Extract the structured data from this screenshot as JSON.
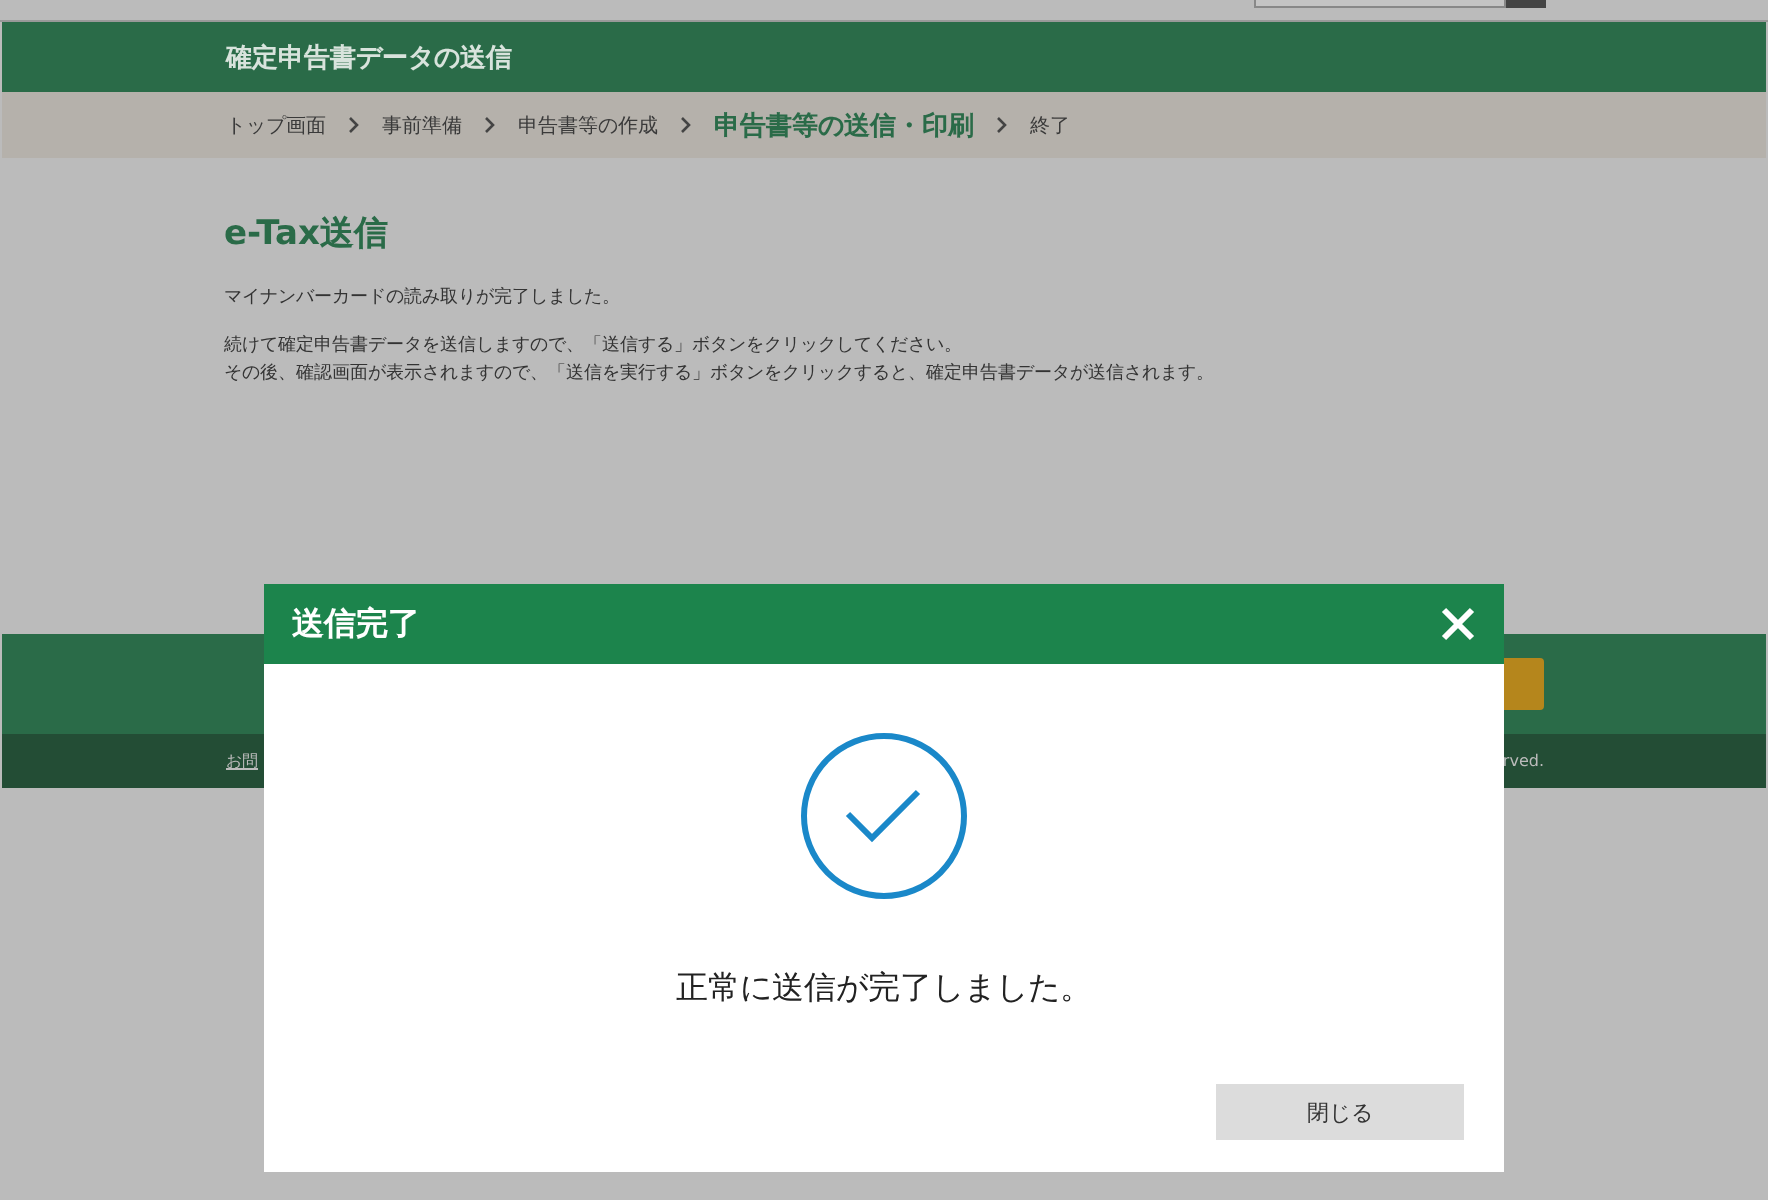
{
  "header": {
    "title": "確定申告書データの送信"
  },
  "breadcrumb": [
    {
      "label": "トップ画面",
      "selected": false
    },
    {
      "label": "事前準備",
      "selected": false
    },
    {
      "label": "申告書等の作成",
      "selected": false
    },
    {
      "label": "申告書等の送信・印刷",
      "selected": true
    },
    {
      "label": "終了",
      "selected": false
    }
  ],
  "content": {
    "heading": "e-Tax送信",
    "paragraphs": [
      [
        "マイナンバーカードの読み取りが完了しました。"
      ],
      [
        "続けて確定申告書データを送信しますので、「送信する」ボタンをクリックしてください。",
        "その後、確認画面が表示されますので、「送信を実行する」ボタンをクリックすると、確定申告書データが送信されます。"
      ]
    ]
  },
  "footer": {
    "link": "お問",
    "copyright": "rved."
  },
  "dialog": {
    "title": "送信完了",
    "message": "正常に送信が完了しました。",
    "button": "閉じる"
  }
}
